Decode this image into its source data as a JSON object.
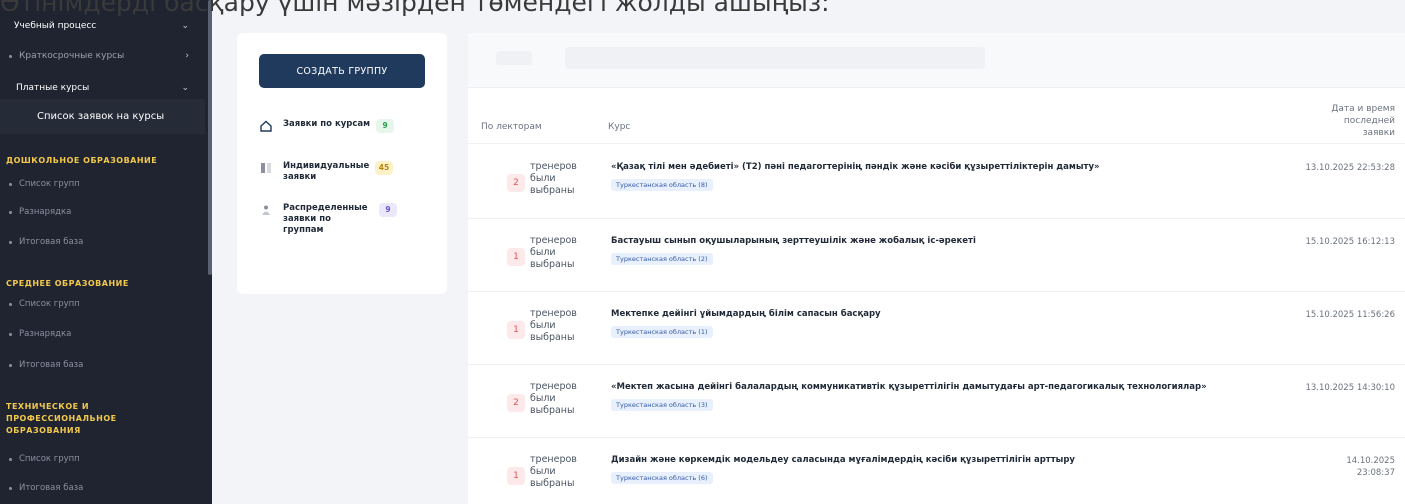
{
  "caption": "Өтінімдерді басқару үшін мәзірден төмендегі жолды ашыңыз:",
  "sidebar": {
    "learning_process": "Учебный процесс",
    "short_courses": "Краткосрочные курсы",
    "paid_courses": "Платные курсы",
    "course_requests": "Список заявок на курсы",
    "sections": [
      {
        "title": "ДОШКОЛЬНОЕ ОБРАЗОВАНИЕ",
        "items": [
          "Список групп",
          "Разнарядка",
          "Итоговая база"
        ]
      },
      {
        "title": "СРЕДНЕЕ ОБРАЗОВАНИЕ",
        "items": [
          "Список групп",
          "Разнарядка",
          "Итоговая база"
        ]
      },
      {
        "title": "ТЕХНИЧЕСКОЕ И ПРОФЕССИОНАЛЬНОЕ ОБРАЗОВАНИЯ",
        "items": [
          "Список групп",
          "Итоговая база"
        ]
      }
    ]
  },
  "left_panel": {
    "create_button": "СОЗДАТЬ ГРУППУ",
    "menu": [
      {
        "label": "Заявки по курсам",
        "count": "9",
        "icon": "home-icon"
      },
      {
        "label": "Индивидуальные заявки",
        "count": "45",
        "icon": "columns-icon"
      },
      {
        "label": "Распределенные заявки по группам",
        "count": "9",
        "icon": "users-icon"
      }
    ]
  },
  "table": {
    "headers": {
      "by_lecturers": "По лекторам",
      "course": "Курс",
      "date": "Дата и время последней заявки"
    },
    "rows": [
      {
        "count": "2",
        "trainers": "тренеров были выбраны",
        "course": "«Қазақ тілі мен әдебиеті» (Т2) пәні педагогтерінің пәндік және кәсіби құзыреттіліктерін дамыту»",
        "region": "Туркестанская область (8)",
        "date": "13.10.2025 22:53:28"
      },
      {
        "count": "1",
        "trainers": "тренеров были выбраны",
        "course": "Бастауыш сынып оқушыларының зерттеушілік және жобалық іс-әрекеті",
        "region": "Туркестанская область (2)",
        "date": "15.10.2025 16:12:13"
      },
      {
        "count": "1",
        "trainers": "тренеров были выбраны",
        "course": "Мектепке дейінгі ұйымдардың білім сапасын басқару",
        "region": "Туркестанская область (1)",
        "date": "15.10.2025 11:56:26"
      },
      {
        "count": "2",
        "trainers": "тренеров были выбраны",
        "course": "«Мектеп жасына дейінгі балалардың коммуникативтік құзыреттілігін дамытудағы арт-педагогикалық технологиялар»",
        "region": "Туркестанская область (3)",
        "date": "13.10.2025 14:30:10"
      },
      {
        "count": "1",
        "trainers": "тренеров были выбраны",
        "course": "Дизайн және көркемдік модельдеу саласында мұғалімдердің кәсіби құзыреттілігін арттыру",
        "region": "Туркестанская область (6)",
        "date": "14.10.2025 23:08:37"
      }
    ]
  }
}
